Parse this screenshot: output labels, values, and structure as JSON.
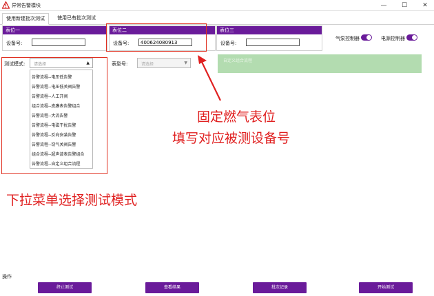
{
  "window": {
    "title": "异常告警模块",
    "minimize": "—",
    "maximize": "☐",
    "close": "✕"
  },
  "tabs": [
    "使用新建批次测试",
    "使用已有批次测试"
  ],
  "meters": [
    {
      "title": "表位一",
      "device_label": "设备号:",
      "device_value": ""
    },
    {
      "title": "表位二",
      "device_label": "设备号:",
      "device_value": "400624080913"
    },
    {
      "title": "表位三",
      "device_label": "设备号:",
      "device_value": ""
    }
  ],
  "toggles": {
    "pump_label": "气泵控制器",
    "power_label": "电源控制器"
  },
  "test_mode": {
    "label": "测试模式:",
    "placeholder": "请选择",
    "options": [
      "告警流程--电压低告警",
      "告警流程--电压低关阀告警",
      "告警流程--人工开阀",
      "组合流程--皮膜表告警组合",
      "告警流程--大流告警",
      "告警流程--电磁干扰告警",
      "告警流程--反向安装告警",
      "告警流程--窃气关阀告警",
      "组合流程--超声波表告警组合",
      "告警流程--自定义组合流程"
    ]
  },
  "meter_type": {
    "label": "表型号:",
    "placeholder": "请选择"
  },
  "custom_flow": {
    "text": "自定义组合流程"
  },
  "annotations": {
    "line1": "固定燃气表位",
    "line2": "填写对应被测设备号",
    "line3": "下拉菜单选择测试模式",
    "color": "#e02020"
  },
  "operations": {
    "label": "操作",
    "buttons": [
      "终止测试",
      "查看结果",
      "批次记录",
      "开始测试"
    ]
  },
  "colors": {
    "accent": "#6a1b9a",
    "custom_box": "#b3dcb0"
  }
}
